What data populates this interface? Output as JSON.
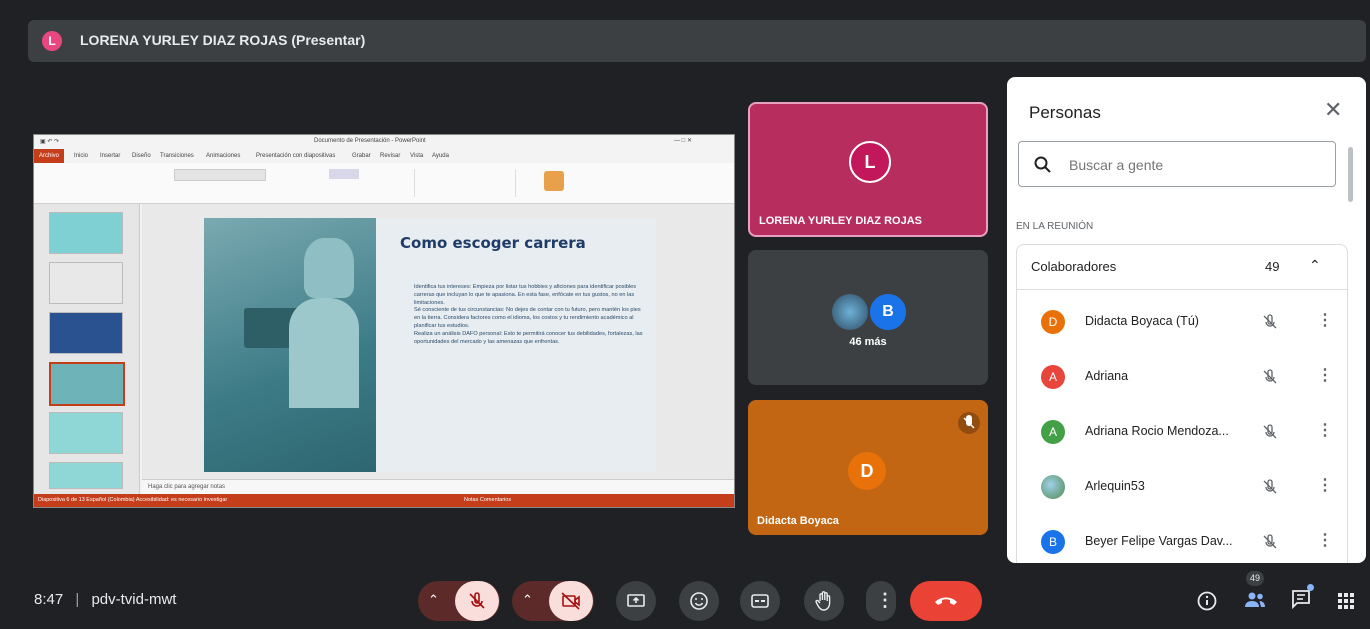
{
  "presenter_bar": {
    "avatar_letter": "L",
    "title": "LORENA YURLEY DIAZ ROJAS (Presentar)"
  },
  "shared_screen": {
    "window_title": "Documento de Presentación - PowerPoint",
    "ribbon_tabs": [
      "Archivo",
      "Inicio",
      "Insertar",
      "Diseño",
      "Transiciones",
      "Animaciones",
      "Presentación con diapositivas",
      "Grabar",
      "Revisar",
      "Vista",
      "Ayuda"
    ],
    "slide": {
      "heading": "Como escoger carrera",
      "bullets": [
        "Identifica tus intereses: Empieza por listar tus hobbies y aficiones para identificar posibles carreras que incluyan lo que te apasiona. En esta fase, enfócate en tus gustos, no en las limitaciones.",
        "Sé consciente de tus circunstancias: No dejes de contar con tu futuro, pero mantén los pies en la tierra. Considera factores como el idioma, los costos y tu rendimiento académico al planificar tus estudios.",
        "Realiza un análisis DAFO personal: Esto te permitirá conocer tus debilidades, fortalezas, las oportunidades del mercado y las amenazas que enfrentas."
      ]
    },
    "notes_placeholder": "Haga clic para agregar notas",
    "status_left": "Diapositiva 6 de 13   Español (Colombia)   Accesibilidad: es necesario investigar",
    "status_right": "Notas   Comentarios"
  },
  "tiles": [
    {
      "avatar_letter": "L",
      "name": "LORENA YURLEY DIAZ ROJAS",
      "color": "#b62d5e"
    },
    {
      "avatar_letter": "B",
      "name": "46 más",
      "color": "#3c4043"
    },
    {
      "avatar_letter": "D",
      "name": "Didacta Boyaca",
      "color": "#c26614"
    }
  ],
  "people_panel": {
    "title": "Personas",
    "search_placeholder": "Buscar a gente",
    "section_label": "EN LA REUNIÓN",
    "group_label": "Colaboradores",
    "group_count": "49",
    "participants": [
      {
        "letter": "D",
        "name": "Didacta Boyaca (Tú)",
        "color": "#e8710a"
      },
      {
        "letter": "A",
        "name": "Adriana",
        "color": "#e8453c"
      },
      {
        "letter": "A",
        "name": "Adriana Rocio Mendoza...",
        "color": "#43a047"
      },
      {
        "letter": "",
        "name": "Arlequin53",
        "color": "#6fa8dc"
      },
      {
        "letter": "B",
        "name": "Beyer Felipe Vargas Dav...",
        "color": "#1a73e8"
      }
    ]
  },
  "bottom_bar": {
    "time": "8:47",
    "meeting_code": "pdv-tvid-mwt",
    "people_badge": "49"
  },
  "icons": [
    "mic-off-icon",
    "camera-off-icon",
    "present-icon",
    "emoji-icon",
    "captions-icon",
    "raise-hand-icon",
    "more-icon",
    "end-call-icon",
    "info-icon",
    "people-icon",
    "chat-icon",
    "activities-icon"
  ]
}
